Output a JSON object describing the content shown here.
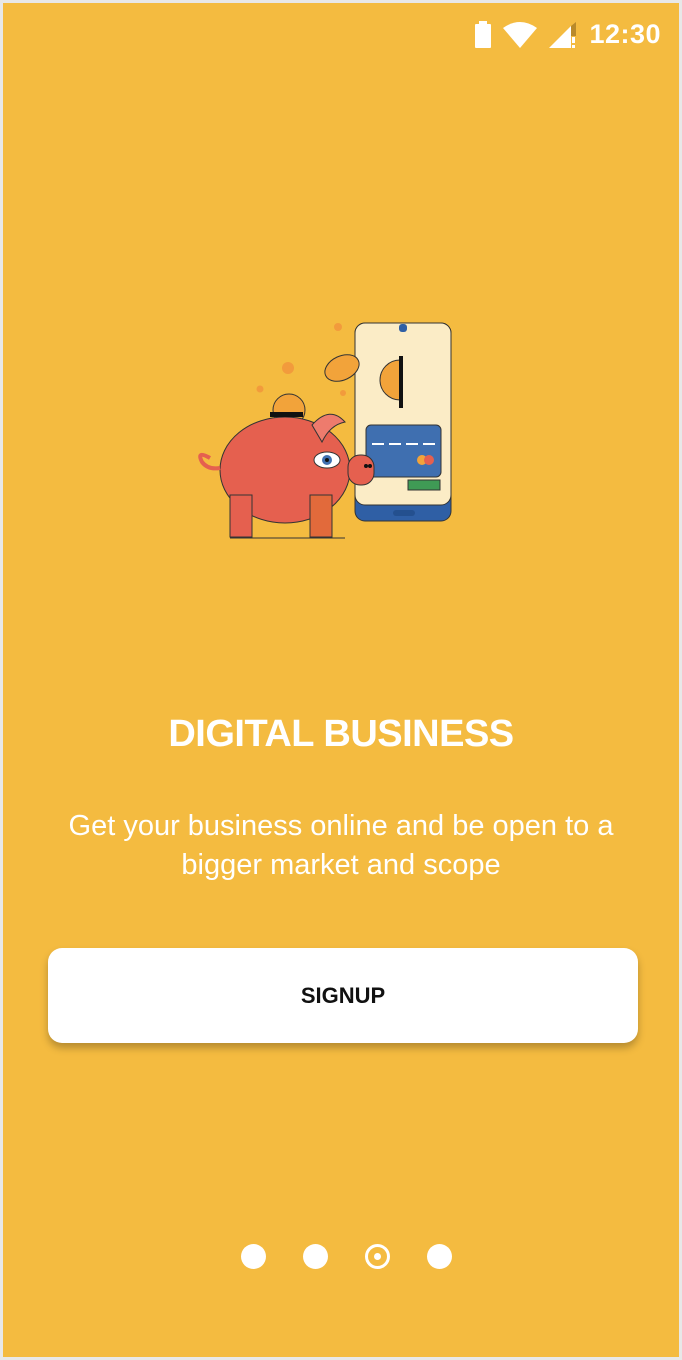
{
  "status_bar": {
    "time": "12:30",
    "icons": [
      "battery-icon",
      "wifi-icon",
      "cell-signal-alert-icon"
    ]
  },
  "onboarding": {
    "title": "DIGITAL BUSINESS",
    "description": "Get your business online and be open to a bigger market and scope",
    "signup_label": "SIGNUP",
    "page_count": 4,
    "current_page": 3
  },
  "colors": {
    "background": "#f4bb40",
    "button": "#ffffff",
    "text": "#ffffff"
  }
}
